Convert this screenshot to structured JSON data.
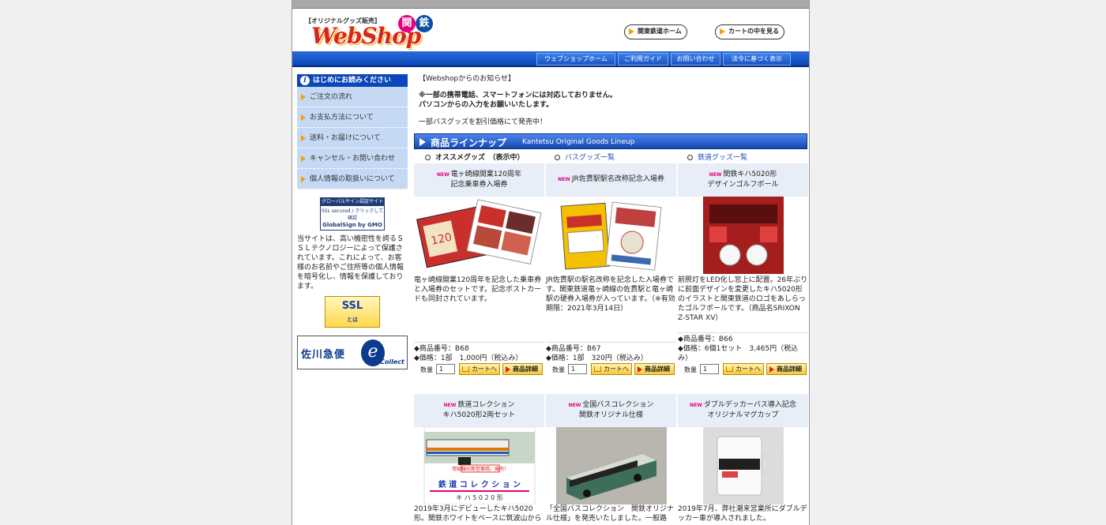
{
  "header": {
    "logo_small": "【オリジナルグッズ販売】",
    "logo_web": "WebShop",
    "logo_kan": "関",
    "logo_tetsu": "鉄",
    "home_button": "関東鉄道ホーム",
    "cart_button": "カートの中を見る"
  },
  "nav": [
    "ウェブショップホーム",
    "ご利用ガイド",
    "お問い合わせ",
    "法令に基づく表示"
  ],
  "sidebar": {
    "head": "はじめにお読みください",
    "items": [
      {
        "label": "ご注文の流れ"
      },
      {
        "label": "お支払方法について"
      },
      {
        "label": "送料・お届けについて"
      },
      {
        "label": "キャンセル・お問い合わせ"
      },
      {
        "label": "個人情報の取扱いについて"
      }
    ],
    "gs_top": "グローバルサイン認証サイト",
    "gs_mid": "SSL secured / クリックして確認",
    "gs_bot": "GlobalSign by GMO",
    "ssl_text": "当サイトは、高い機密性を誇るＳＳＬテクノロジーによって保護されています。これによって、お客様のお名前やご住所等の個人情報を暗号化し、情報を保護しております。",
    "ssl_btn": "SSL",
    "ssl_btn_sub": "とは",
    "sagawa_brand": "佐川急便",
    "sagawa_e": "e",
    "sagawa_collect": "Collect"
  },
  "notice": {
    "title": "【Webshopからのお知らせ】",
    "line1": "※一部の携帯電話、スマートフォンには対応しておりません。",
    "line2": "パソコンからの入力をお願いいたします。",
    "sale": "一部バスグッズを割引価格にて発売中！"
  },
  "lineup": {
    "jp": "商品ラインナップ",
    "en": "Kantetsu Original Goods Lineup"
  },
  "tabs": [
    "オススメグッズ　（表示中）",
    "バスグッズ一覧",
    "鉄道グッズ一覧"
  ],
  "common": {
    "new_tag": "NEW",
    "qty_label": "数量",
    "qty_value": "1",
    "cart_label": "カートへ",
    "detail_label": "商品詳細"
  },
  "products": [
    {
      "title1": "竜ヶ崎線開業120周年",
      "title2": "記念乗車券入場券",
      "desc": "竜ヶ崎線開業120周年を記念した乗車券と入場券のセットです。記念ポストカードも同封されています。",
      "code": "◆商品番号：B68",
      "price": "◆価格：1部　1,000円（税込み）"
    },
    {
      "title1": "JR佐貫駅駅名改称記念入場券",
      "title2": "",
      "desc": "JR佐貫駅の駅名改称を記念した入場券です。関東鉄道竜ヶ崎線の佐貫駅と竜ヶ崎駅の硬券入場券が入っています。（※有効期限：2021年3月14日）",
      "code": "◆商品番号：B67",
      "price": "◆価格：1部　320円（税込み）"
    },
    {
      "title1": "関鉄キハ5020形",
      "title2": "デザインゴルフボール",
      "desc": "前照灯をLED化し窓上に配置。26年ぶりに前面デザインを変更したキハ5020形のイラストと関東鉄道のロゴをあしらったゴルフボールです。（商品名SRIXON Z-STAR XV）",
      "code": "◆商品番号：B66",
      "price": "◆価格：6個1セット　3,465円（税込み）"
    },
    {
      "title1": "鉄道コレクション",
      "title2": "キハ5020形2両セット",
      "desc": "2019年3月にデビューしたキハ5020形。関鉄ホワイトをベースに筑波山から",
      "img_banner": "常総線の新型車両、発売！",
      "img_text": "鉄 道 コ レ ク シ ョ ン",
      "img_sub": "キ ハ 5 0 2 0 形"
    },
    {
      "title1": "全国バスコレクション",
      "title2": "関鉄オリジナル仕様",
      "desc": "「全国バスコレクション　関鉄オリジナル仕様」を発売いたしました。一般路"
    },
    {
      "title1": "ダブルデッカーバス導入記念",
      "title2": "オリジナルマグカップ",
      "desc": "2019年7月、弊社潮来営業所にダブルデッカー車が導入されました。"
    }
  ],
  "colors": {
    "nav_blue": "#0b47b8",
    "accent_red": "#d9261c",
    "accent_orange": "#f5a000",
    "sidebar_bg": "#c6d9f4"
  }
}
